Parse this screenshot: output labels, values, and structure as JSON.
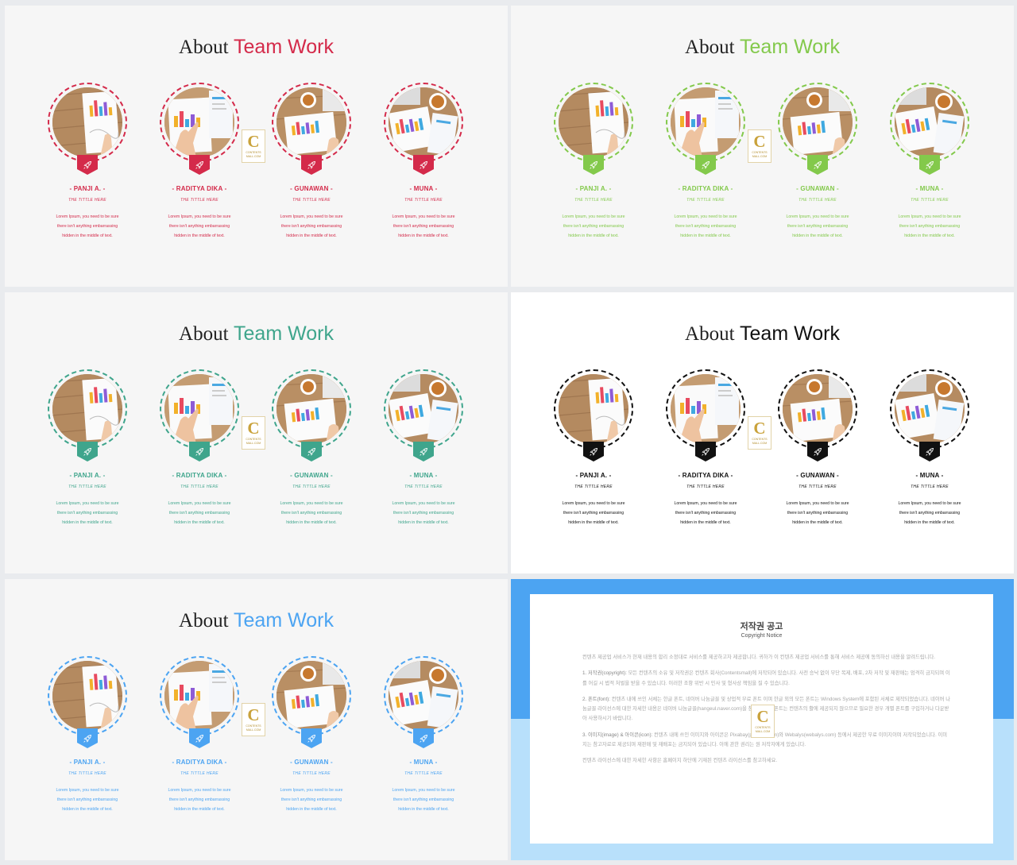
{
  "about_word": "About",
  "team_word": "Team Work",
  "members": [
    {
      "name": "- PANJI A. -",
      "role": "THE TITTLE HERE"
    },
    {
      "name": "- RADITYA DIKA -",
      "role": "THE TITTLE HERE"
    },
    {
      "name": "- GUNAWAN -",
      "role": "THE TITTLE HERE"
    },
    {
      "name": "- MUNA -",
      "role": "THE TITTLE HERE"
    }
  ],
  "desc_lines": [
    "Lorem Ipsum, you need to be sure",
    "there isn't anything embarrassing",
    "hidden in the middle of text."
  ],
  "logo": {
    "letter": "C",
    "line1": "CONTENTS",
    "line2": "MALL.COM"
  },
  "themes": [
    {
      "accent": "#d42a4a",
      "background": "#f6f6f6"
    },
    {
      "accent": "#83c94b",
      "background": "#f6f6f6"
    },
    {
      "accent": "#3fa58c",
      "background": "#f6f6f6"
    },
    {
      "accent": "#111111",
      "background": "#ffffff"
    },
    {
      "accent": "#4ca4f2",
      "background": "#f6f6f6"
    }
  ],
  "badge_icon": "rocket-icon",
  "notice": {
    "title": "저작권 공고",
    "subtitle": "Copyright Notice",
    "intro": "컨텐츠 제공업 서비스가 현재 내용의 합리 소정대로 서비스를 제공하고자 제공합니다. 귀하가 이 컨텐츠 제공업 서비스를 통해 서비스 제공에 동의하신 내용을 알려드립니다.",
    "p1_head": "1. 저작권(copyright):",
    "p1": " 모든 컨텐츠의 소유 및 저작권은 컨텐츠 회사(Contentsmall)에 저작되어 있습니다. 사전 승낙 없이 무단 복제, 배포, 2차 저작 및 재판매는 엄격히 금지되며 이를 어길 시 법적 처벌을 받을 수 있습니다. 이러한 조항 위반 시 민사 및 형사상 책임을 질 수 있습니다.",
    "p2_head": "2. 폰트(font):",
    "p2": " 컨텐츠 내에 쓰인 서체는 한글 폰트, 네이버 나눔글꼴 및 상업적 무료 폰트 이며 한글 외의 모든 폰트는 Windows System에 포함된 서체로 제작되었습니다. 네이버 나눔글꼴 라이선스에 대한 자세한 내용은 네이버 나눔글꼴(hangeul.naver.com)을 참고하세요. 폰트는 컨텐츠의 활에 제공되지 않으므로 필요한 경우 개별 폰트를 구입하거나 다운받아 사용하시기 바랍니다.",
    "p3_head": "3. 이미지(image) & 아이콘(icon):",
    "p3": " 컨텐츠 내에 쓰인 이미지와 아이콘은 Pixabay(pixabay.com)와 Webalys(webalys.com) 등에서 제공한 무료 이미지이며 저작되었습니다. 이미지는 참고자료로 제공되며 재판매 및 재배포는 금지되어 있습니다. 이에 관한 권리는 원 저작자에게 있습니다.",
    "outro": "컨텐츠 라이선스에 대한 자세한 사항은 홈페이지 하단에 기재된 컨텐츠 라이선스를 참고하세요."
  }
}
